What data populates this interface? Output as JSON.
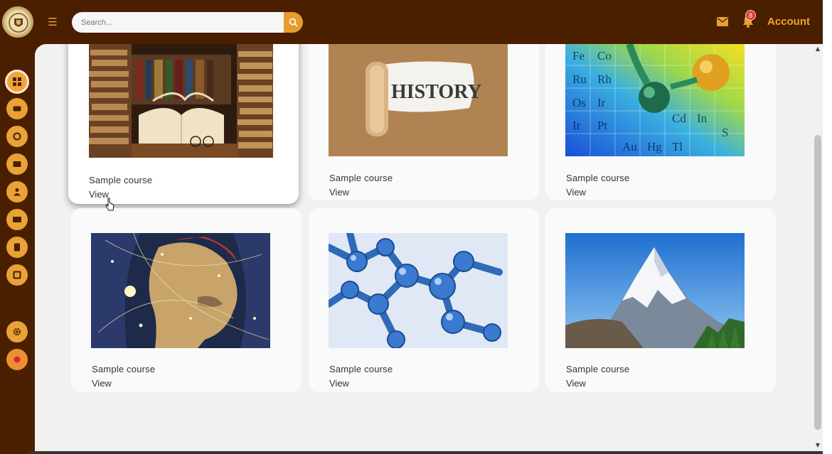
{
  "header": {
    "search_placeholder": "Search...",
    "notification_count": "8",
    "account_label": "Account",
    "accent_color": "#e59c2e",
    "bar_color": "#4a1f00"
  },
  "sidebar": {
    "items": [
      {
        "icon": "dashboard-icon",
        "active": true
      },
      {
        "icon": "courses-icon",
        "active": false
      },
      {
        "icon": "progress-icon",
        "active": false
      },
      {
        "icon": "messages-icon",
        "active": false
      },
      {
        "icon": "users-icon",
        "active": false
      },
      {
        "icon": "payments-icon",
        "active": false
      },
      {
        "icon": "profile-icon",
        "active": false
      },
      {
        "icon": "reports-icon",
        "active": false
      },
      {
        "icon": "settings-icon",
        "active": false
      },
      {
        "icon": "logout-icon",
        "active": false
      }
    ]
  },
  "courses": [
    {
      "title": "Sample course",
      "action": "View",
      "image": "books-icon"
    },
    {
      "title": "Sample course",
      "action": "View",
      "image": "history-scroll-icon",
      "image_text": "HISTORY"
    },
    {
      "title": "Sample course",
      "action": "View",
      "image": "periodic-table-icon"
    },
    {
      "title": "Sample course",
      "action": "View",
      "image": "constellation-face-icon"
    },
    {
      "title": "Sample course",
      "action": "View",
      "image": "molecule-icon"
    },
    {
      "title": "Sample course",
      "action": "View",
      "image": "mountain-icon"
    }
  ]
}
